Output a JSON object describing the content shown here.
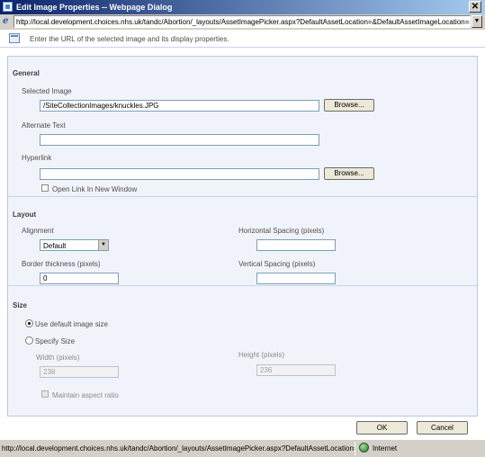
{
  "window": {
    "title": "Edit Image Properties -- Webpage Dialog",
    "close_glyph": "✕",
    "address_url": "http://local.development.choices.nhs.uk/tandc/Abortion/_layouts/AssetImagePicker.aspx?DefaultAssetLocation=&DefaultAssetImageLocation=&",
    "address_icon": "ie-page-icon",
    "dropdown_glyph": "▼"
  },
  "dialog": {
    "hint": "Enter the URL of the selected image and its display properties.",
    "hint_icon": "dialog-info-icon"
  },
  "general": {
    "heading": "General",
    "selected_image_label": "Selected Image",
    "selected_image_value": "/SiteCollectionImages/knuckles.JPG",
    "browse_label": "Browse...",
    "alt_text_label": "Alternate Text",
    "alt_text_value": "",
    "hyperlink_label": "Hyperlink",
    "hyperlink_value": "",
    "hyperlink_browse_label": "Browse...",
    "open_new_window_label": "Open Link In New Window",
    "open_new_window_checked": false
  },
  "layout": {
    "heading": "Layout",
    "alignment_label": "Alignment",
    "alignment_value": "Default",
    "border_label": "Border thickness (pixels)",
    "border_value": "0",
    "hspacing_label": "Horizontal Spacing (pixels)",
    "hspacing_value": "",
    "vspacing_label": "Vertical Spacing (pixels)",
    "vspacing_value": ""
  },
  "size": {
    "heading": "Size",
    "use_default_label": "Use default image size",
    "use_default_selected": true,
    "specify_label": "Specify Size",
    "width_label": "Width (pixels)",
    "width_value": "238",
    "height_label": "Height (pixels)",
    "height_value": "236",
    "aspect_label": "Maintain aspect ratio",
    "aspect_checked": false
  },
  "buttons": {
    "ok": "OK",
    "cancel": "Cancel"
  },
  "status": {
    "text": "http://local.development.choices.nhs.uk/tandc/Abortion/_layouts/AssetImagePicker.aspx?DefaultAssetLocation=&DefaultAssetImageLocation=&",
    "zone": "Internet",
    "zone_icon": "globe-icon"
  },
  "colors": {
    "titlebar": "#0a246a",
    "panel_background": "#f0f4fa",
    "panel_border": "#b9c9e3",
    "input_border": "#7f9db9"
  }
}
